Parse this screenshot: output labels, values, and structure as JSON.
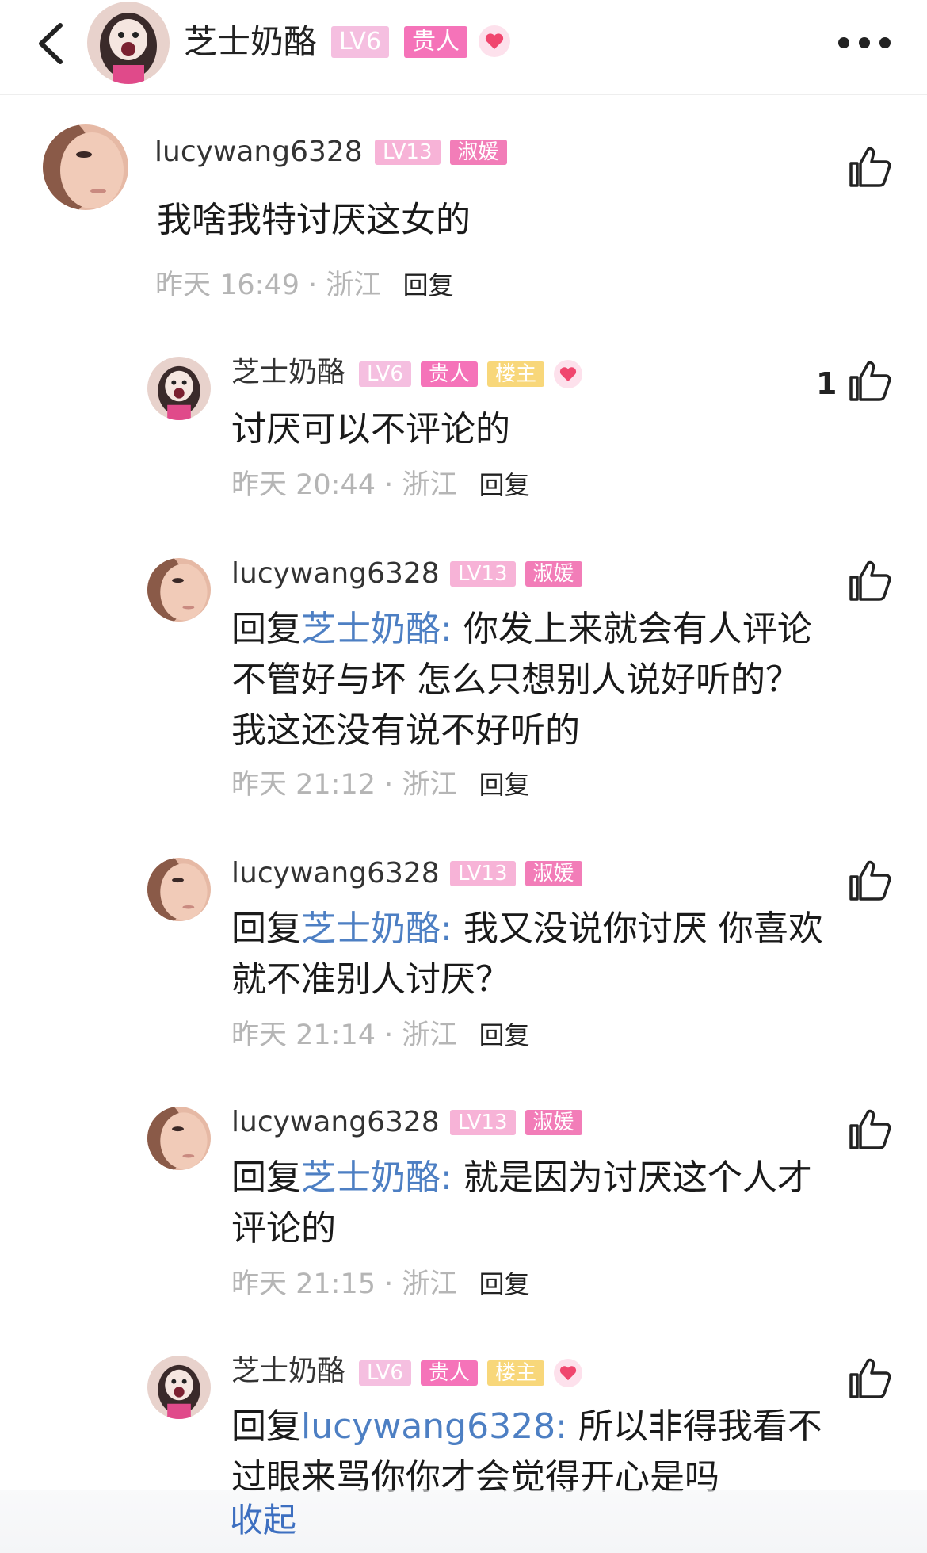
{
  "header": {
    "back_icon": "chevron-left-icon",
    "name": "芝士奶酪",
    "badges": [
      "LV6",
      "贵人"
    ],
    "heart_icon": "heart-icon",
    "more_icon": "more-dots-icon"
  },
  "comments": [
    {
      "user": "lucywang6328",
      "badges": [
        "LV13",
        "淑媛"
      ],
      "lines": [
        "我啥我特讨厌这女的"
      ],
      "time": "昨天 16:49",
      "location": "浙江",
      "reply_label": "回复"
    },
    {
      "user": "芝士奶酪",
      "badges": [
        "LV6",
        "贵人",
        "楼主"
      ],
      "lines": [
        "讨厌可以不评论的"
      ],
      "time": "昨天 20:44",
      "location": "浙江",
      "reply_label": "回复",
      "likes": "1"
    },
    {
      "user": "lucywang6328",
      "badges": [
        "LV13",
        "淑媛"
      ],
      "reply_prefix": "回复",
      "mention": "芝士奶酪:",
      "lines": [
        "你发上来就会有人评论",
        "不管好与坏  怎么只想别人说好听的？",
        "我这还没有说不好听的"
      ],
      "time": "昨天 21:12",
      "location": "浙江",
      "reply_label": "回复"
    },
    {
      "user": "lucywang6328",
      "badges": [
        "LV13",
        "淑媛"
      ],
      "reply_prefix": "回复",
      "mention": "芝士奶酪:",
      "lines": [
        "我又没说你讨厌  你喜欢",
        "就不准别人讨厌？"
      ],
      "time": "昨天 21:14",
      "location": "浙江",
      "reply_label": "回复"
    },
    {
      "user": "lucywang6328",
      "badges": [
        "LV13",
        "淑媛"
      ],
      "reply_prefix": "回复",
      "mention": "芝士奶酪:",
      "lines": [
        "就是因为讨厌这个人才",
        "评论的"
      ],
      "time": "昨天 21:15",
      "location": "浙江",
      "reply_label": "回复"
    },
    {
      "user": "芝士奶酪",
      "badges": [
        "LV6",
        "贵人",
        "楼主"
      ],
      "reply_prefix": "回复",
      "mention": "lucywang6328:",
      "lines": [
        "所以非得我看不",
        "过眼来骂你你才会觉得开心是吗"
      ]
    }
  ],
  "collapse_label": "收起",
  "separator": "·"
}
